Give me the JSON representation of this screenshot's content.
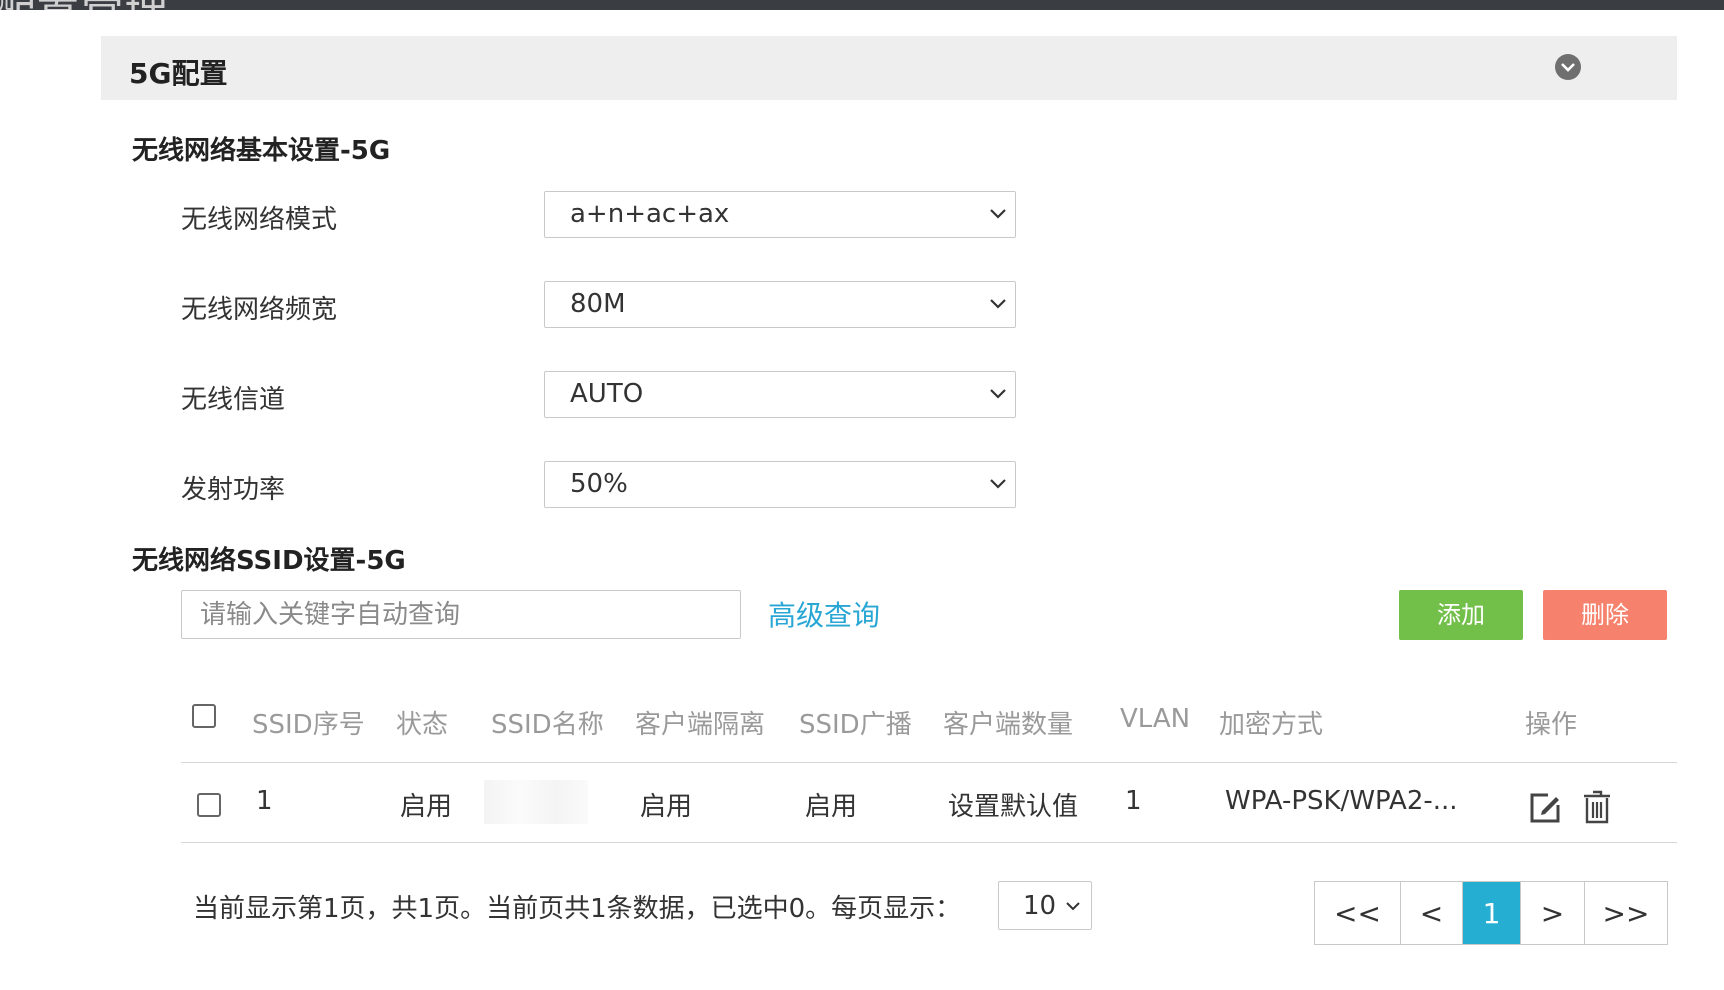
{
  "header": {
    "partial_title": "配置管理"
  },
  "panel": {
    "title": "5G配置"
  },
  "basic": {
    "title": "无线网络基本设置-5G",
    "mode": {
      "label": "无线网络模式",
      "value": "a+n+ac+ax"
    },
    "bandwidth": {
      "label": "无线网络频宽",
      "value": "80M"
    },
    "channel": {
      "label": "无线信道",
      "value": "AUTO"
    },
    "power": {
      "label": "发射功率",
      "value": "50%"
    }
  },
  "ssid": {
    "title": "无线网络SSID设置-5G",
    "search_placeholder": "请输入关键字自动查询",
    "advanced_query": "高级查询",
    "add_label": "添加",
    "delete_label": "删除",
    "columns": [
      "SSID序号",
      "状态",
      "SSID名称",
      "客户端隔离",
      "SSID广播",
      "客户端数量",
      "VLAN",
      "加密方式",
      "操作"
    ],
    "rows": [
      {
        "index": "1",
        "status": "启用",
        "name": "",
        "isolation": "启用",
        "broadcast": "启用",
        "clients": "设置默认值",
        "vlan": "1",
        "encryption": "WPA-PSK/WPA2-..."
      }
    ]
  },
  "pagination": {
    "summary": "当前显示第1页，共1页。当前页共1条数据，已选中0。每页显示：",
    "page_size": "10",
    "first": "<<",
    "prev": "<",
    "current": "1",
    "next": ">",
    "last": ">>"
  },
  "icons": {
    "collapse": "chevron-circle-icon",
    "edit": "edit-icon",
    "delete": "trash-icon",
    "select_arrow": "chevron-down-icon"
  },
  "colors": {
    "accent_link": "#28a6d4",
    "add_button": "#72bf4a",
    "delete_button": "#f6826d",
    "pager_active": "#25aed2",
    "panel_header": "#eeeeee"
  }
}
